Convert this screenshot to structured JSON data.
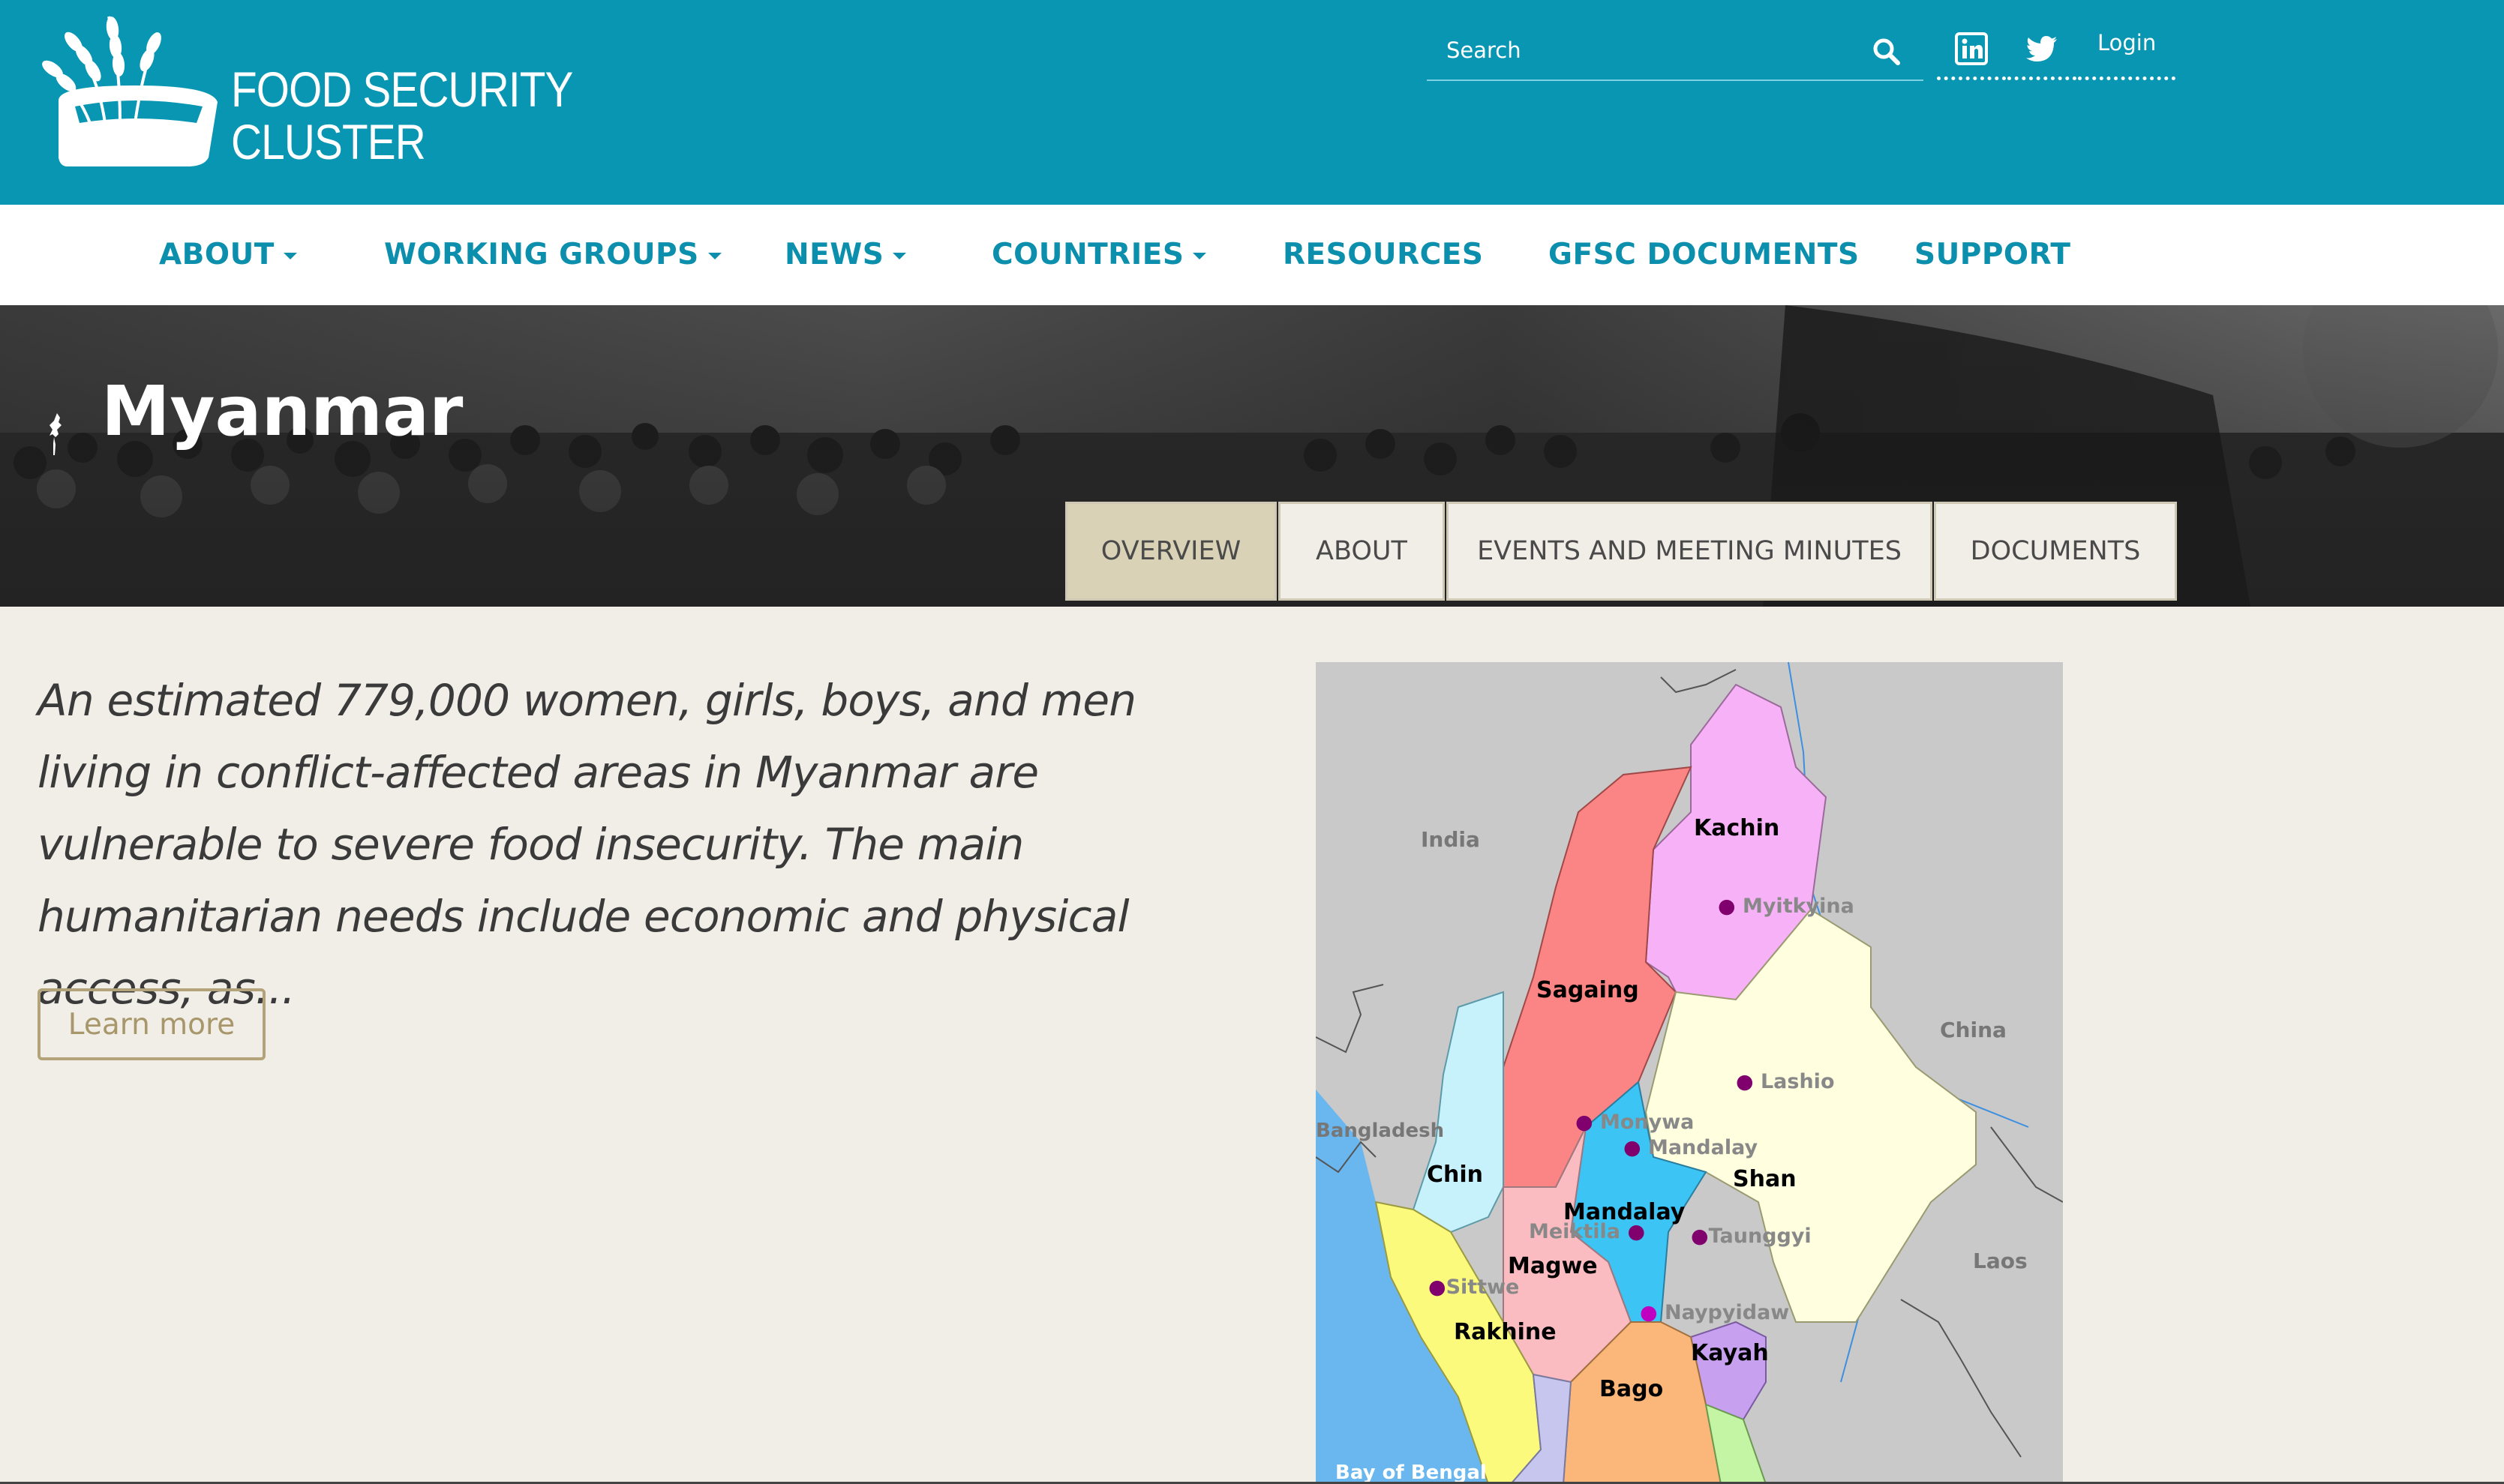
{
  "header": {
    "logo_text_line1": "FOOD SECURITY",
    "logo_text_line2": "CLUSTER",
    "search_placeholder": "Search",
    "login_label": "Login",
    "brand_color": "#0896b3"
  },
  "nav": {
    "items": [
      {
        "label": "ABOUT",
        "dropdown": true
      },
      {
        "label": "WORKING GROUPS",
        "dropdown": true
      },
      {
        "label": "NEWS",
        "dropdown": true
      },
      {
        "label": "COUNTRIES",
        "dropdown": true
      },
      {
        "label": "RESOURCES",
        "dropdown": false
      },
      {
        "label": "GFSC DOCUMENTS",
        "dropdown": false
      },
      {
        "label": "SUPPORT",
        "dropdown": false
      }
    ]
  },
  "page": {
    "title": "Myanmar",
    "tabs": [
      {
        "label": "OVERVIEW",
        "active": true
      },
      {
        "label": "ABOUT",
        "active": false
      },
      {
        "label": "EVENTS AND MEETING MINUTES",
        "active": false
      },
      {
        "label": "DOCUMENTS",
        "active": false
      }
    ],
    "intro_text": "An estimated 779,000 women, girls, boys, and men living in conflict-affected areas in Myanmar are vulnerable to severe food insecurity. The main humanitarian needs include economic and physical access, as...",
    "learn_more_label": "Learn more"
  },
  "map": {
    "country_labels": [
      "India",
      "China",
      "Bangladesh",
      "Laos",
      "Bay of Bengal"
    ],
    "region_labels": [
      "Kachin",
      "Sagaing",
      "Chin",
      "Shan",
      "Mandalay",
      "Magwe",
      "Rakhine",
      "Kayah",
      "Bago"
    ],
    "city_labels": [
      "Myitkyina",
      "Lashio",
      "Monywa",
      "Mandalay",
      "Meiktila",
      "Taunggyi",
      "Sittwe",
      "Naypyidaw"
    ]
  }
}
